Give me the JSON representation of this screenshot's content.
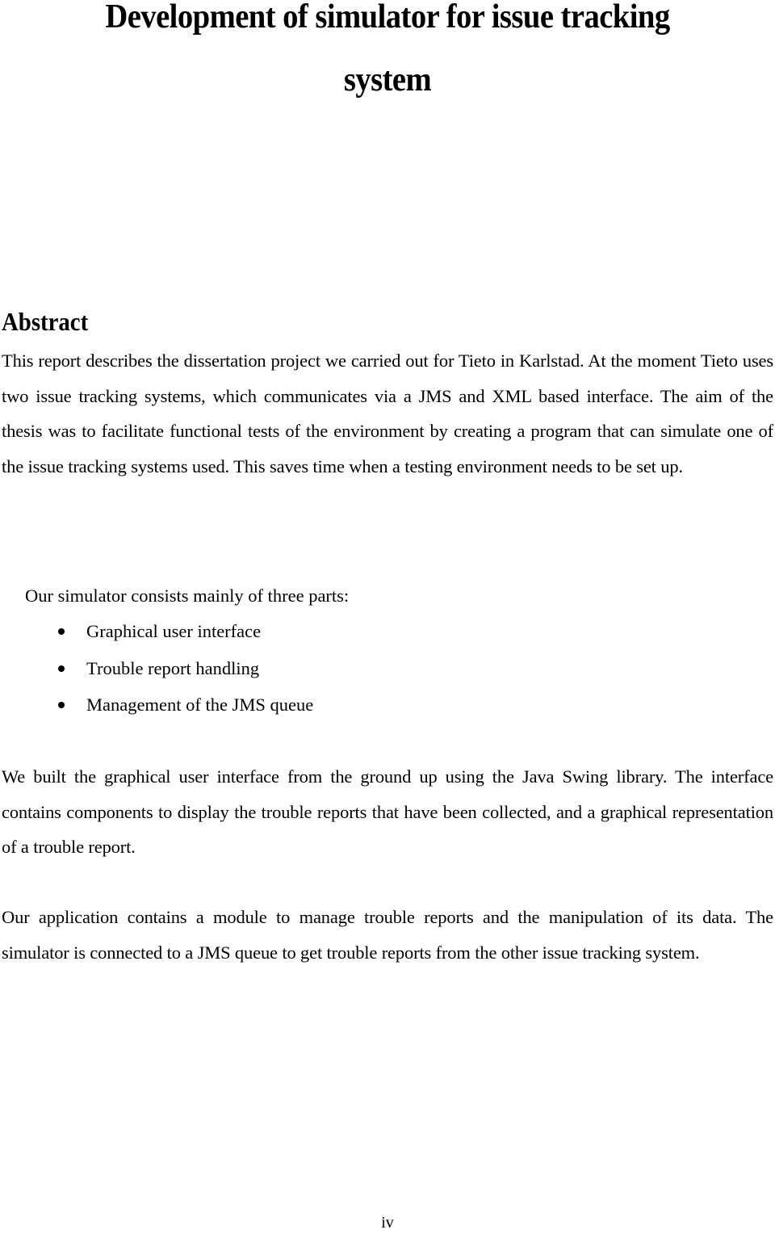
{
  "document": {
    "title_lines": [
      "Development of simulator for issue tracking",
      "system"
    ],
    "abstract": {
      "heading": "Abstract",
      "paragraph_1": "This report describes the dissertation project we carried out for Tieto in Karlstad. At the moment Tieto uses two issue tracking systems, which communicates via a JMS and XML based interface. The aim of the thesis was to facilitate functional tests of the environment by creating a program that can simulate one of the issue tracking systems used. This saves time when a testing environment needs to be set up.",
      "parts_intro": "Our simulator consists mainly of three parts:",
      "parts": [
        "Graphical user interface",
        "Trouble report handling",
        "Management of the JMS queue"
      ],
      "paragraph_2": "We built the graphical user interface from the ground up using the Java Swing library. The interface contains components to display the trouble reports that have been collected, and a graphical representation of a trouble report.",
      "paragraph_3": "Our application contains a module to manage trouble reports and the manipulation of its data. The simulator is connected to a JMS queue to get trouble reports from the other issue tracking system."
    },
    "page_number": "iv"
  }
}
